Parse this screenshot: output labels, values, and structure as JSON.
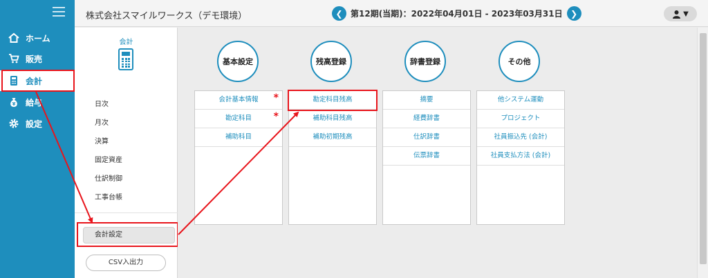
{
  "nav": {
    "items": [
      {
        "label": "ホーム",
        "icon": "home-icon"
      },
      {
        "label": "販売",
        "icon": "cart-icon"
      },
      {
        "label": "会計",
        "icon": "calculator-icon"
      },
      {
        "label": "給与",
        "icon": "money-bag-icon"
      },
      {
        "label": "設定",
        "icon": "gear-icon"
      }
    ],
    "active_index": 2
  },
  "header": {
    "company": "株式会社スマイルワークス（デモ環境）",
    "period": "第12期(当期)：2022年04月01日 - 2023年03月31日"
  },
  "submenu": {
    "title": "会計",
    "items": [
      "日次",
      "月次",
      "決算",
      "固定資産",
      "仕訳制御",
      "工事台帳"
    ],
    "settings_label": "会計設定",
    "csv_label": "CSV入出力"
  },
  "categories": [
    {
      "title": "基本設定",
      "links": [
        {
          "label": "会計基本情報",
          "required": true
        },
        {
          "label": "勘定科目",
          "required": true
        },
        {
          "label": "補助科目",
          "required": false
        }
      ]
    },
    {
      "title": "残高登録",
      "links": [
        {
          "label": "勘定科目残高",
          "required": false
        },
        {
          "label": "補助科目残高",
          "required": false
        },
        {
          "label": "補助初期残高",
          "required": false
        }
      ]
    },
    {
      "title": "辞書登録",
      "links": [
        {
          "label": "摘要",
          "required": false
        },
        {
          "label": "経費辞書",
          "required": false
        },
        {
          "label": "仕訳辞書",
          "required": false
        },
        {
          "label": "伝票辞書",
          "required": false
        }
      ]
    },
    {
      "title": "その他",
      "links": [
        {
          "label": "他システム運動",
          "required": false
        },
        {
          "label": "プロジェクト",
          "required": false
        },
        {
          "label": "社員振込先 (会計)",
          "required": false
        },
        {
          "label": "社員支払方法 (会計)",
          "required": false
        }
      ]
    }
  ],
  "colors": {
    "accent": "#1e8ebd",
    "highlight": "#e8141b"
  }
}
